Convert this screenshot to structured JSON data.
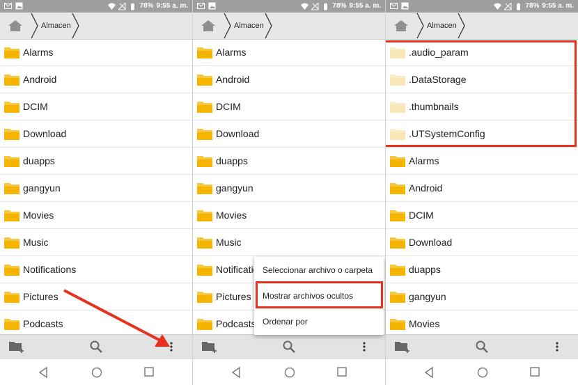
{
  "colors": {
    "accent": "#e8301f",
    "folder": "#f5b400",
    "folder_hidden": "#f7e7b6"
  },
  "status": {
    "battery": "78%",
    "time": "9:55 a. m."
  },
  "breadcrumb": {
    "label": "Almacen"
  },
  "panels": [
    {
      "rows": [
        "Alarms",
        "Android",
        "DCIM",
        "Download",
        "duapps",
        "gangyun",
        "Movies",
        "Music",
        "Notifications",
        "Pictures",
        "Podcasts"
      ]
    },
    {
      "rows": [
        "Alarms",
        "Android",
        "DCIM",
        "Download",
        "duapps",
        "gangyun",
        "Movies",
        "Music",
        "Notifications",
        "Pictures",
        "Podcasts"
      ]
    },
    {
      "hidden_rows": [
        ".audio_param",
        ".DataStorage",
        ".thumbnails",
        ".UTSystemConfig"
      ],
      "rows": [
        "Alarms",
        "Android",
        "DCIM",
        "Download",
        "duapps",
        "gangyun",
        "Movies"
      ]
    }
  ],
  "menu": {
    "items": [
      "Seleccionar archivo o carpeta",
      "Mostrar archivos ocultos",
      "Ordenar por"
    ]
  },
  "icons": {
    "home": "home-icon",
    "new_folder": "new-folder-icon",
    "search": "search-icon",
    "more": "more-vert-icon",
    "back": "nav-back-icon",
    "home_nav": "nav-home-icon",
    "recents": "nav-recents-icon"
  }
}
